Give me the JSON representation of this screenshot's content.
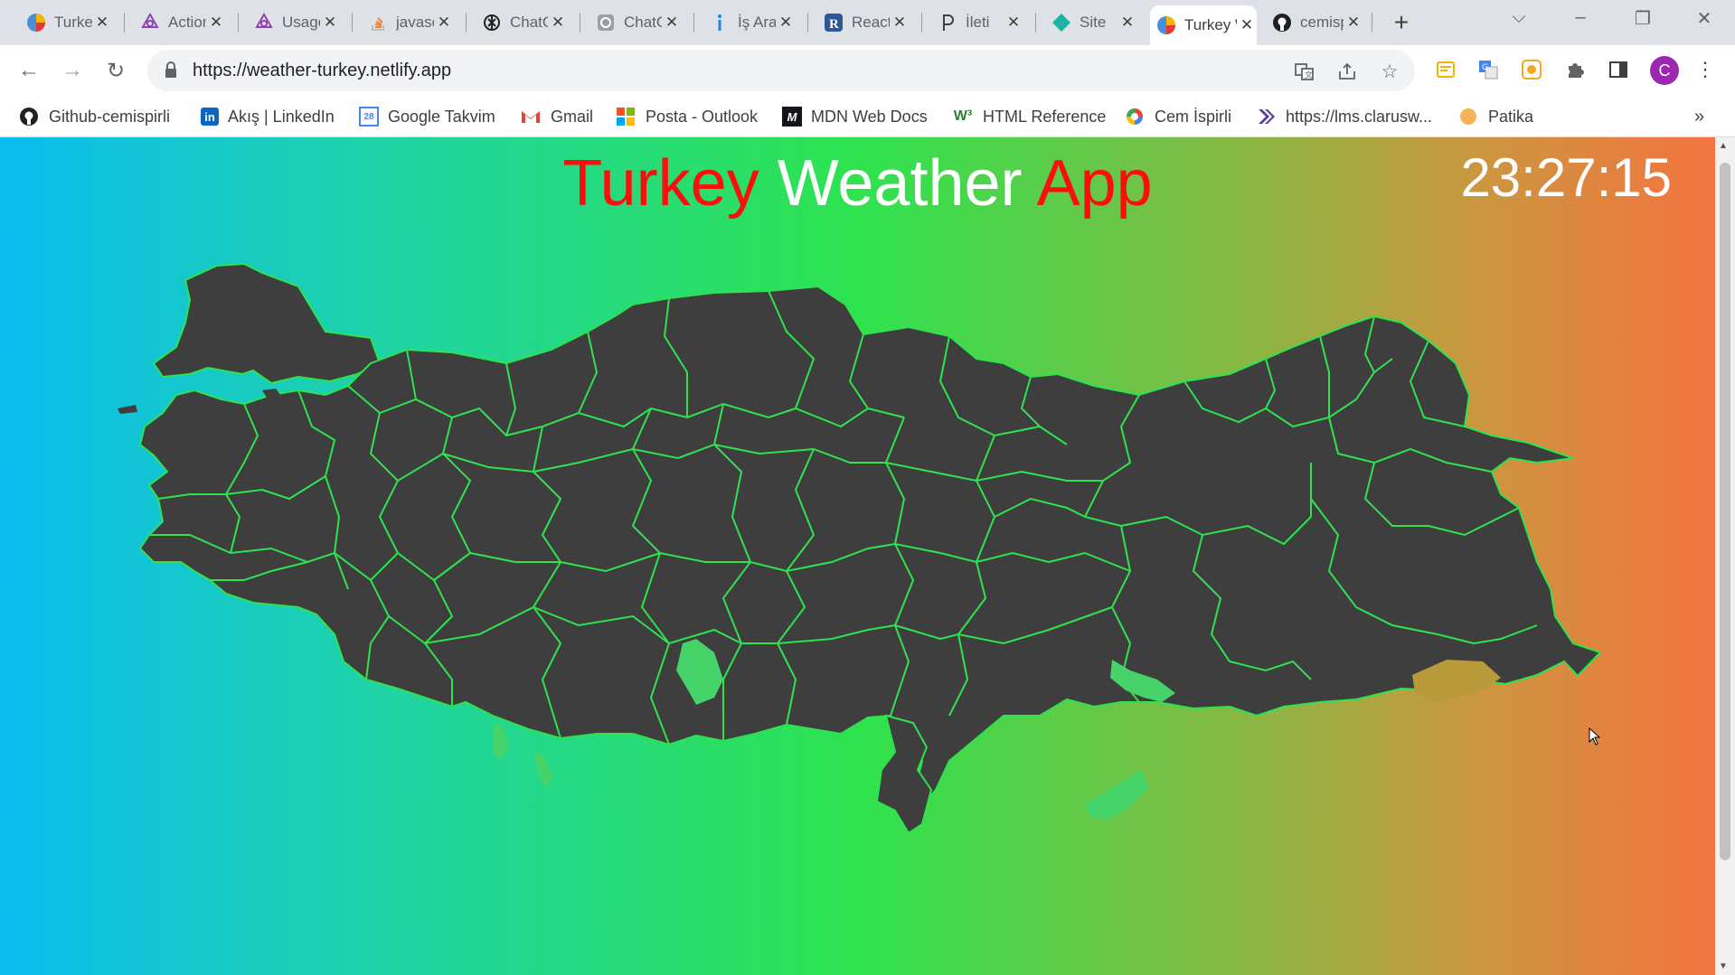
{
  "tabs": [
    {
      "title": "Turkey Weather App",
      "icon": "weather-app-icon"
    },
    {
      "title": "Action",
      "icon": "react-flow-icon"
    },
    {
      "title": "Usage",
      "icon": "react-flow-icon"
    },
    {
      "title": "javascript",
      "icon": "stackoverflow-icon"
    },
    {
      "title": "ChatGPT",
      "icon": "openai-icon"
    },
    {
      "title": "ChatGPT",
      "icon": "openai-icon"
    },
    {
      "title": "İş Arama",
      "icon": "kariyer-icon"
    },
    {
      "title": "React",
      "icon": "react-r-icon"
    },
    {
      "title": "İleti",
      "icon": "p-icon"
    },
    {
      "title": "Site",
      "icon": "diamond-icon"
    },
    {
      "title": "Turkey Weather App",
      "icon": "weather-app-icon",
      "active": true
    },
    {
      "title": "cemispirli",
      "icon": "github-icon"
    }
  ],
  "toolbar": {
    "url": "https://weather-turkey.netlify.app"
  },
  "profile": {
    "initial": "C",
    "color": "#9c27b0"
  },
  "bookmarks": [
    {
      "label": "Github-cemispirli",
      "icon": "github-icon"
    },
    {
      "label": "Akış | LinkedIn",
      "icon": "linkedin-icon"
    },
    {
      "label": "Google Takvim",
      "icon": "google-calendar-icon"
    },
    {
      "label": "Gmail",
      "icon": "gmail-icon"
    },
    {
      "label": "Posta - Outlook",
      "icon": "microsoft-icon"
    },
    {
      "label": "MDN Web Docs",
      "icon": "mdn-icon"
    },
    {
      "label": "HTML Reference",
      "icon": "w3-icon"
    },
    {
      "label": "Cem İspirli",
      "icon": "swirl-icon"
    },
    {
      "label": "https://lms.clarusw...",
      "icon": "clarusway-icon"
    },
    {
      "label": "Patika",
      "icon": "patika-icon"
    }
  ],
  "page": {
    "title_parts": [
      "Turkey",
      "Weather",
      "App"
    ],
    "clock": "23:27:15",
    "colors": {
      "title_red": "#ff0d0d",
      "map_fill": "#3e3e3e",
      "province_border": "#2ee34e",
      "lakes": "#45d36a"
    }
  }
}
